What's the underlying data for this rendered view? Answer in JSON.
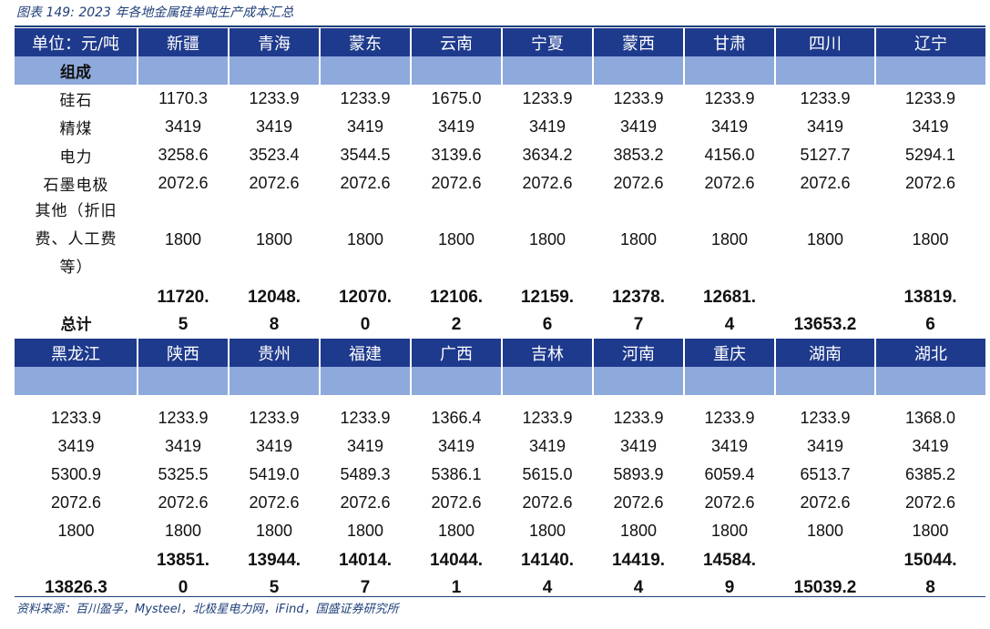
{
  "caption": "图表 149: 2023 年各地金属硅单吨生产成本汇总",
  "source": "资料来源：百川盈孚，Mysteel，北极星电力网，iFind，国盛证券研究所",
  "table1": {
    "header": [
      "单位：元/吨",
      "新疆",
      "青海",
      "蒙东",
      "云南",
      "宁夏",
      "蒙西",
      "甘肃",
      "四川",
      "辽宁"
    ],
    "group_label": "组成",
    "rows": [
      {
        "label": "硅石",
        "values": [
          "1170.3",
          "1233.9",
          "1233.9",
          "1675.0",
          "1233.9",
          "1233.9",
          "1233.9",
          "1233.9",
          "1233.9"
        ]
      },
      {
        "label": "精煤",
        "values": [
          "3419",
          "3419",
          "3419",
          "3419",
          "3419",
          "3419",
          "3419",
          "3419",
          "3419"
        ]
      },
      {
        "label": "电力",
        "values": [
          "3258.6",
          "3523.4",
          "3544.5",
          "3139.6",
          "3634.2",
          "3853.2",
          "4156.0",
          "5127.7",
          "5294.1"
        ]
      },
      {
        "label": "石墨电极",
        "values": [
          "2072.6",
          "2072.6",
          "2072.6",
          "2072.6",
          "2072.6",
          "2072.6",
          "2072.6",
          "2072.6",
          "2072.6"
        ]
      },
      {
        "label_lines": [
          "其他（折旧",
          "费、人工费",
          "等）"
        ],
        "values": [
          "1800",
          "1800",
          "1800",
          "1800",
          "1800",
          "1800",
          "1800",
          "1800",
          "1800"
        ]
      }
    ],
    "total": {
      "label": "总计",
      "values": [
        {
          "top": "11720.",
          "bottom": "5"
        },
        {
          "top": "12048.",
          "bottom": "8"
        },
        {
          "top": "12070.",
          "bottom": "0"
        },
        {
          "top": "12106.",
          "bottom": "2"
        },
        {
          "top": "12159.",
          "bottom": "6"
        },
        {
          "top": "12378.",
          "bottom": "7"
        },
        {
          "top": "12681.",
          "bottom": "4"
        },
        {
          "top": "",
          "bottom": "13653.2"
        },
        {
          "top": "13819.",
          "bottom": "6"
        }
      ]
    }
  },
  "table2": {
    "header": [
      "黑龙江",
      "陕西",
      "贵州",
      "福建",
      "广西",
      "吉林",
      "河南",
      "重庆",
      "湖南",
      "湖北"
    ],
    "rows": [
      [
        "1233.9",
        "1233.9",
        "1233.9",
        "1233.9",
        "1366.4",
        "1233.9",
        "1233.9",
        "1233.9",
        "1233.9",
        "1368.0"
      ],
      [
        "3419",
        "3419",
        "3419",
        "3419",
        "3419",
        "3419",
        "3419",
        "3419",
        "3419",
        "3419"
      ],
      [
        "5300.9",
        "5325.5",
        "5419.0",
        "5489.3",
        "5386.1",
        "5615.0",
        "5893.9",
        "6059.4",
        "6513.7",
        "6385.2"
      ],
      [
        "2072.6",
        "2072.6",
        "2072.6",
        "2072.6",
        "2072.6",
        "2072.6",
        "2072.6",
        "2072.6",
        "2072.6",
        "2072.6"
      ],
      [
        "1800",
        "1800",
        "1800",
        "1800",
        "1800",
        "1800",
        "1800",
        "1800",
        "1800",
        "1800"
      ]
    ],
    "total": [
      {
        "top": "",
        "bottom": "13826.3"
      },
      {
        "top": "13851.",
        "bottom": "0"
      },
      {
        "top": "13944.",
        "bottom": "5"
      },
      {
        "top": "14014.",
        "bottom": "7"
      },
      {
        "top": "14044.",
        "bottom": "1"
      },
      {
        "top": "14140.",
        "bottom": "4"
      },
      {
        "top": "14419.",
        "bottom": "4"
      },
      {
        "top": "14584.",
        "bottom": "9"
      },
      {
        "top": "",
        "bottom": "15039.2"
      },
      {
        "top": "15044.",
        "bottom": "8"
      }
    ]
  }
}
